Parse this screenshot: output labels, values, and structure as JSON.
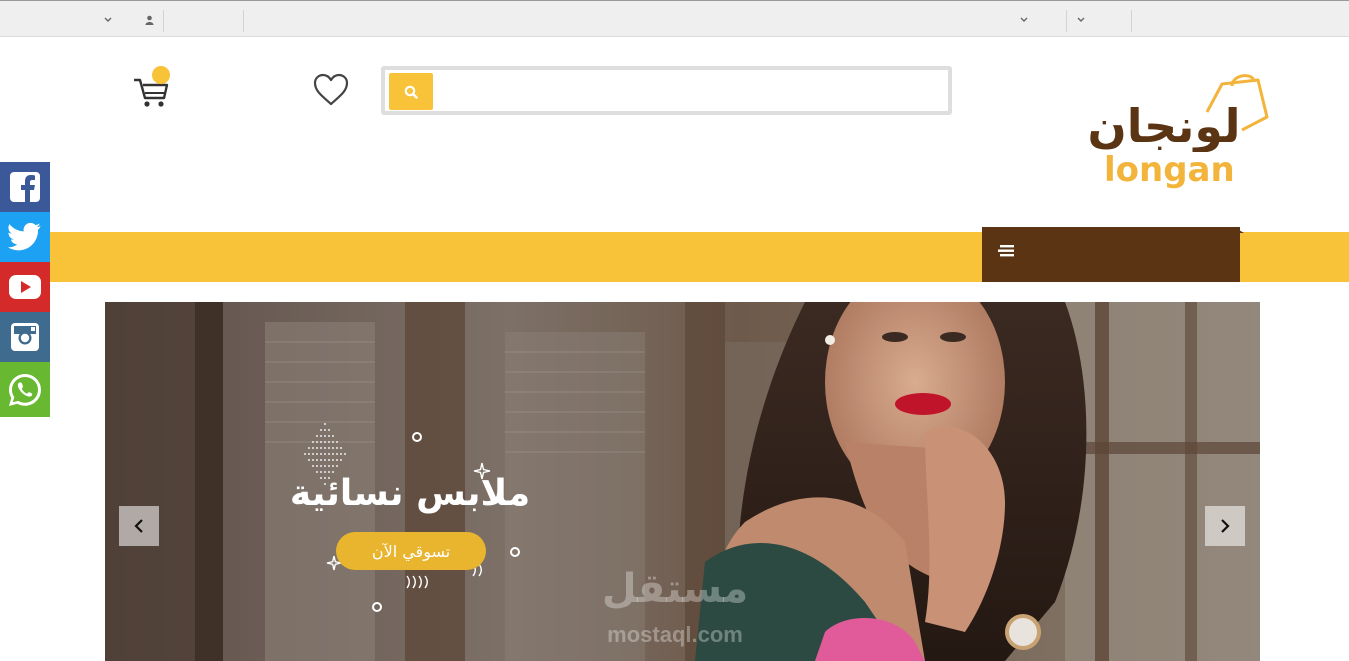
{
  "topbar": {
    "left_dropdown_icon": "chevron-down-icon",
    "account_icon": "user-icon",
    "right_dropdown_1_icon": "chevron-down-icon",
    "right_dropdown_2_icon": "chevron-down-icon"
  },
  "header": {
    "logo_text_ar": "لونجان",
    "logo_text_en": "longan",
    "search": {
      "placeholder": "",
      "value": "",
      "button_icon": "search-icon"
    },
    "wishlist_icon": "heart-icon",
    "cart_icon": "cart-icon",
    "cart_badge": ""
  },
  "nav": {
    "categories_icon": "menu-icon",
    "categories_label": ""
  },
  "social": [
    {
      "name": "facebook",
      "color": "#3b5998"
    },
    {
      "name": "twitter",
      "color": "#1da1f2"
    },
    {
      "name": "youtube",
      "color": "#d42a2a"
    },
    {
      "name": "instagram",
      "color": "#3f6b8e"
    },
    {
      "name": "whatsapp",
      "color": "#69b832"
    }
  ],
  "hero": {
    "title": "ملابس نسائية",
    "button_label": "تسوقي الآن",
    "prev_icon": "chevron-left-icon",
    "next_icon": "chevron-right-icon",
    "watermark_ar": "مستقل",
    "watermark_en": "mostaql.com"
  },
  "colors": {
    "accent": "#f8c338",
    "brand_brown": "#5b3413",
    "logo_orange": "#f2b43b"
  }
}
